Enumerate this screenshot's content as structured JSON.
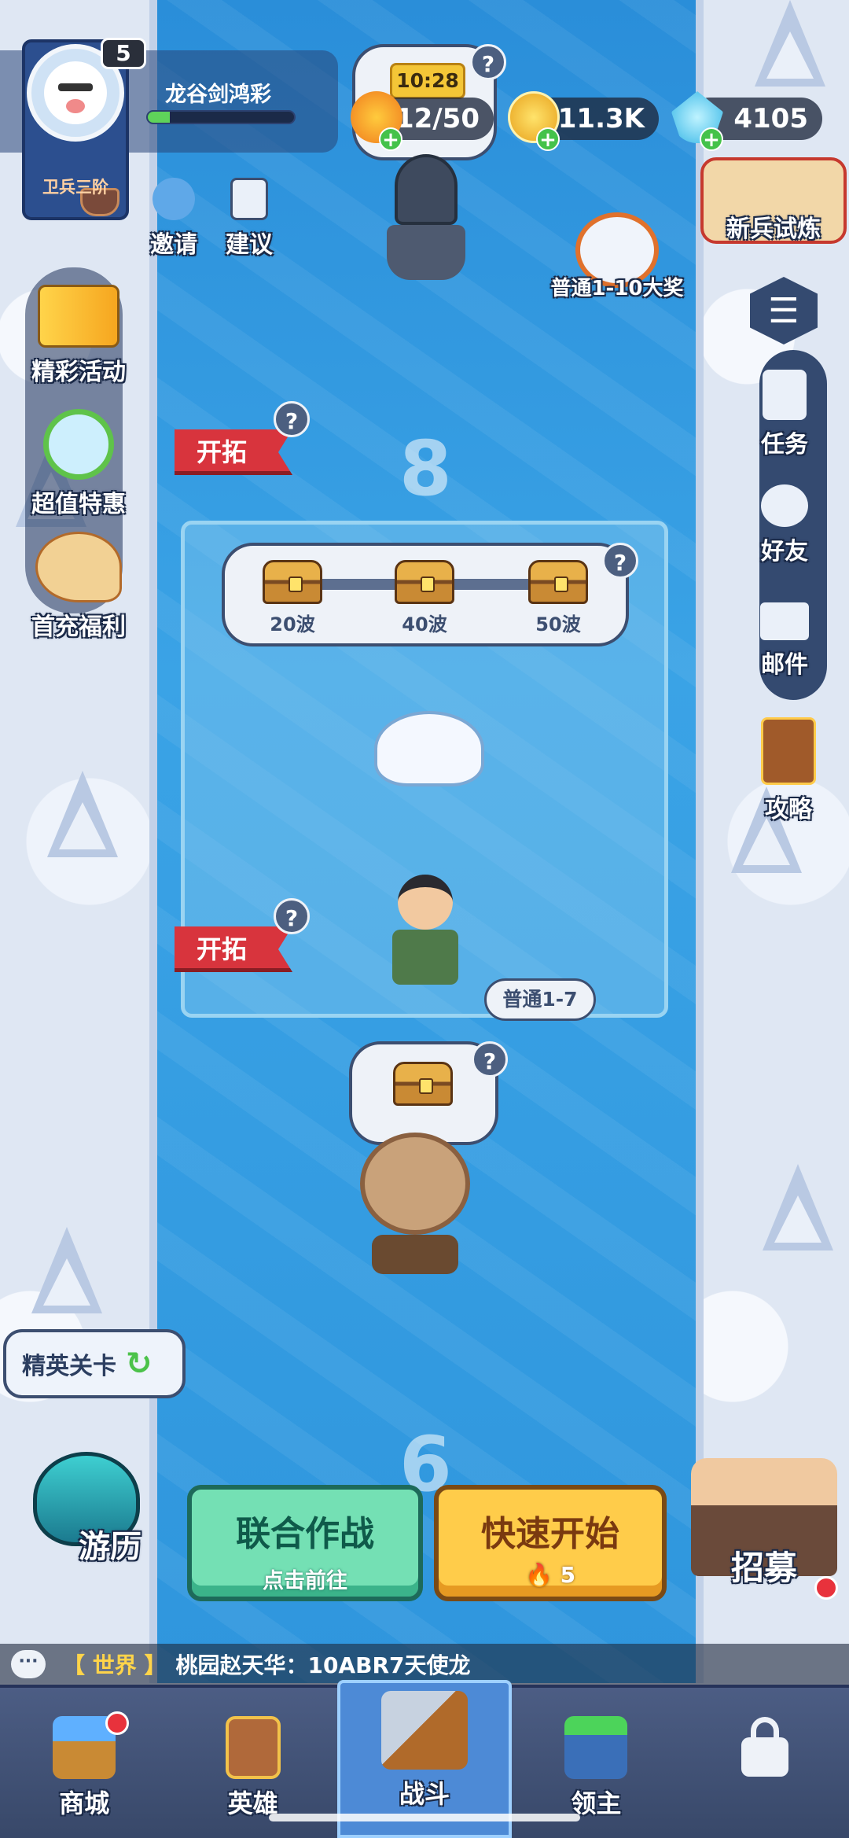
{
  "player": {
    "level": "5",
    "name": "龙谷剑鸿彩",
    "rank": "卫兵三阶",
    "xp_progress": 0.15
  },
  "resources": {
    "timer": "10:28",
    "energy": "12/50",
    "gold": "11.3K",
    "gems": "4105"
  },
  "top_actions": {
    "invite": "邀请",
    "suggest": "建议",
    "new_recruit_trial": "新兵试炼",
    "reward_label": "普通1-10大奖"
  },
  "left_menu": {
    "events": "精彩活动",
    "special_offer": "超值特惠",
    "first_recharge": "首充福利",
    "elite_stage": "精英关卡",
    "travel": "游历"
  },
  "right_menu": {
    "tasks": "任务",
    "friends": "好友",
    "mail": "邮件",
    "guide": "攻略",
    "recruit": "招募"
  },
  "stages": {
    "explore_label": "开拓",
    "stage_8": "8",
    "stage_6": "6",
    "wave_rewards": [
      "20波",
      "40波",
      "50波"
    ],
    "current_stage": "普通1-7"
  },
  "buttons": {
    "co_op": "联合作战",
    "co_op_sub": "点击前往",
    "quick_start": "快速开始",
    "quick_start_cost": "5"
  },
  "chat": {
    "channel": "【 世界 】",
    "message": "桃园赵天华：10ABR7天使龙"
  },
  "nav": {
    "shop": "商城",
    "heroes": "英雄",
    "battle": "战斗",
    "lord": "领主"
  },
  "help_mark": "?"
}
